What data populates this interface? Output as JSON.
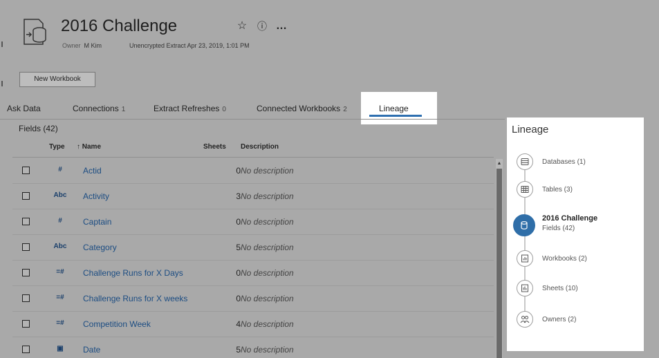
{
  "header": {
    "title": "2016 Challenge",
    "owner_label": "Owner",
    "owner_name": "M Kim",
    "extract_info": "Unencrypted Extract  Apr 23, 2019, 1:01 PM",
    "new_workbook_label": "New Workbook",
    "favorite_icon": "☆",
    "info_icon": "ⓘ",
    "more_icon": "…"
  },
  "tabs": [
    {
      "label": "Ask Data",
      "count": ""
    },
    {
      "label": "Connections",
      "count": "1"
    },
    {
      "label": "Extract Refreshes",
      "count": "0"
    },
    {
      "label": "Connected Workbooks",
      "count": "2"
    },
    {
      "label": "Lineage",
      "count": ""
    }
  ],
  "fields": {
    "header": "Fields (42)",
    "columns": {
      "type": "Type",
      "name": "↑ Name",
      "sheets": "Sheets",
      "description": "Description"
    },
    "rows": [
      {
        "type": "#",
        "name": "Actid",
        "sheets": "0",
        "description": "No description"
      },
      {
        "type": "Abc",
        "name": "Activity",
        "sheets": "3",
        "description": "No description"
      },
      {
        "type": "#",
        "name": "Captain",
        "sheets": "0",
        "description": "No description"
      },
      {
        "type": "Abc",
        "name": "Category",
        "sheets": "5",
        "description": "No description"
      },
      {
        "type": "=#",
        "name": "Challenge Runs for X Days",
        "sheets": "0",
        "description": "No description"
      },
      {
        "type": "=#",
        "name": "Challenge Runs for X weeks",
        "sheets": "0",
        "description": "No description"
      },
      {
        "type": "=#",
        "name": "Competition Week",
        "sheets": "4",
        "description": "No description"
      },
      {
        "type": "▣",
        "name": "Date",
        "sheets": "5",
        "description": "No description"
      }
    ]
  },
  "lineage": {
    "title": "Lineage",
    "items": [
      {
        "label": "Databases (1)",
        "icon": "database-icon"
      },
      {
        "label": "Tables (3)",
        "icon": "table-icon"
      },
      {
        "label": "2016  Challenge",
        "sub": "Fields (42)",
        "icon": "datasource-icon",
        "active": true
      },
      {
        "label": "Workbooks (2)",
        "icon": "workbook-icon"
      },
      {
        "label": "Sheets (10)",
        "icon": "sheet-icon"
      },
      {
        "label": "Owners (2)",
        "icon": "owners-icon"
      }
    ]
  },
  "colors": {
    "accent": "#2f6ea8",
    "link": "#1b4c82",
    "overlay": "#a9a9a9"
  }
}
